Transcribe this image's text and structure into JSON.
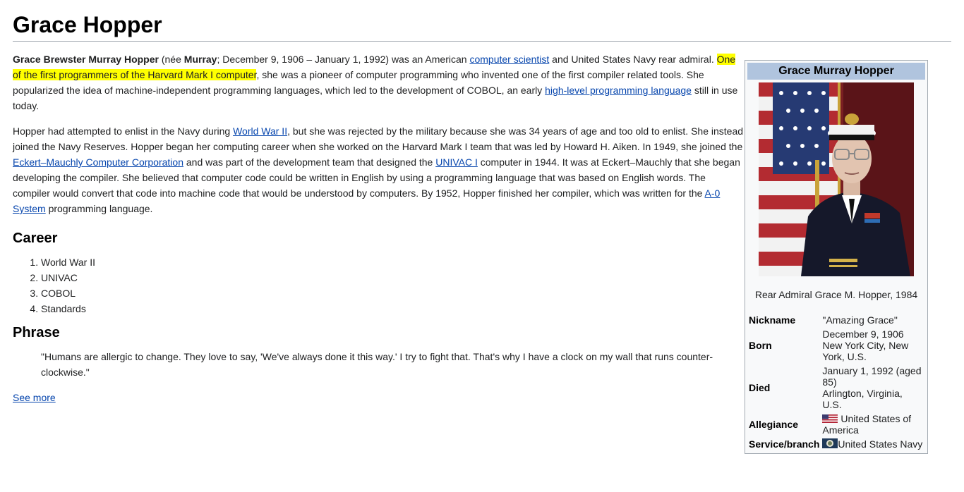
{
  "page": {
    "title": "Grace Hopper"
  },
  "intro": {
    "bold_name": "Grace Brewster Murray Hopper",
    "nee_open": " (née ",
    "bold_maiden": "Murray",
    "text1": "; December 9, 1906 – January 1, 1992) was an American ",
    "link_computer_scientist": "computer scientist",
    "text2": " and United States Navy rear admiral. ",
    "highlight": "One of the first programmers of the Harvard Mark I computer",
    "text3": ", she was a pioneer of computer programming who invented one of the first compiler related tools. She popularized the idea of machine-independent programming languages, which led to the development of COBOL, an early ",
    "link_hll": "high-level programming language",
    "text4": " still in use today."
  },
  "para2": {
    "text1": "Hopper had attempted to enlist in the Navy during ",
    "link_ww2": "World War II",
    "text2": ", but she was rejected by the military because she was 34 years of age and too old to enlist. She instead joined the Navy Reserves. Hopper began her computing career when she worked on the Harvard Mark I team that was led by Howard H. Aiken. In 1949, she joined the ",
    "link_emcc": "Eckert–Mauchly Computer Corporation",
    "text3": " and was part of the development team that designed the ",
    "link_univac": "UNIVAC I",
    "text4": " computer in 1944. It was at Eckert–Mauchly that she began developing the compiler. She believed that computer code could be written in English by using a programming language that was based on English words. The compiler would convert that code into machine code that would be understood by computers. By 1952, Hopper finished her compiler, which was written for the ",
    "link_a0": "A-0 System",
    "text5": " programming language."
  },
  "career": {
    "heading": "Career",
    "items": [
      "World War II",
      "UNIVAC",
      "COBOL",
      "Standards"
    ]
  },
  "phrase": {
    "heading": "Phrase",
    "quote": "\"Humans are allergic to change. They love to say, 'We've always done it this way.' I try to fight that. That's why I have a clock on my wall that runs counter-clockwise.\""
  },
  "see_more": "See more",
  "infobox": {
    "title": "Grace Murray Hopper",
    "caption": "Rear Admiral Grace M. Hopper, 1984",
    "nickname_label": "Nickname",
    "nickname_value": "\"Amazing Grace\"",
    "born_label": "Born",
    "born_date": "December 9, 1906",
    "born_place": "New York City, New York, U.S.",
    "died_label": "Died",
    "died_date": "January 1, 1992 (aged 85)",
    "died_place": "Arlington, Virginia, U.S.",
    "allegiance_label": "Allegiance",
    "allegiance_value": "United States of America",
    "branch_label": "Service/branch",
    "branch_value": "United States Navy",
    "flag_icon": "us-flag-icon",
    "seal_icon": "navy-flag-icon"
  },
  "colors": {
    "link": "#0645ad",
    "highlight": "#ffff00",
    "infobox_title_bg": "#b0c4de",
    "infobox_bg": "#f8f9fa"
  }
}
